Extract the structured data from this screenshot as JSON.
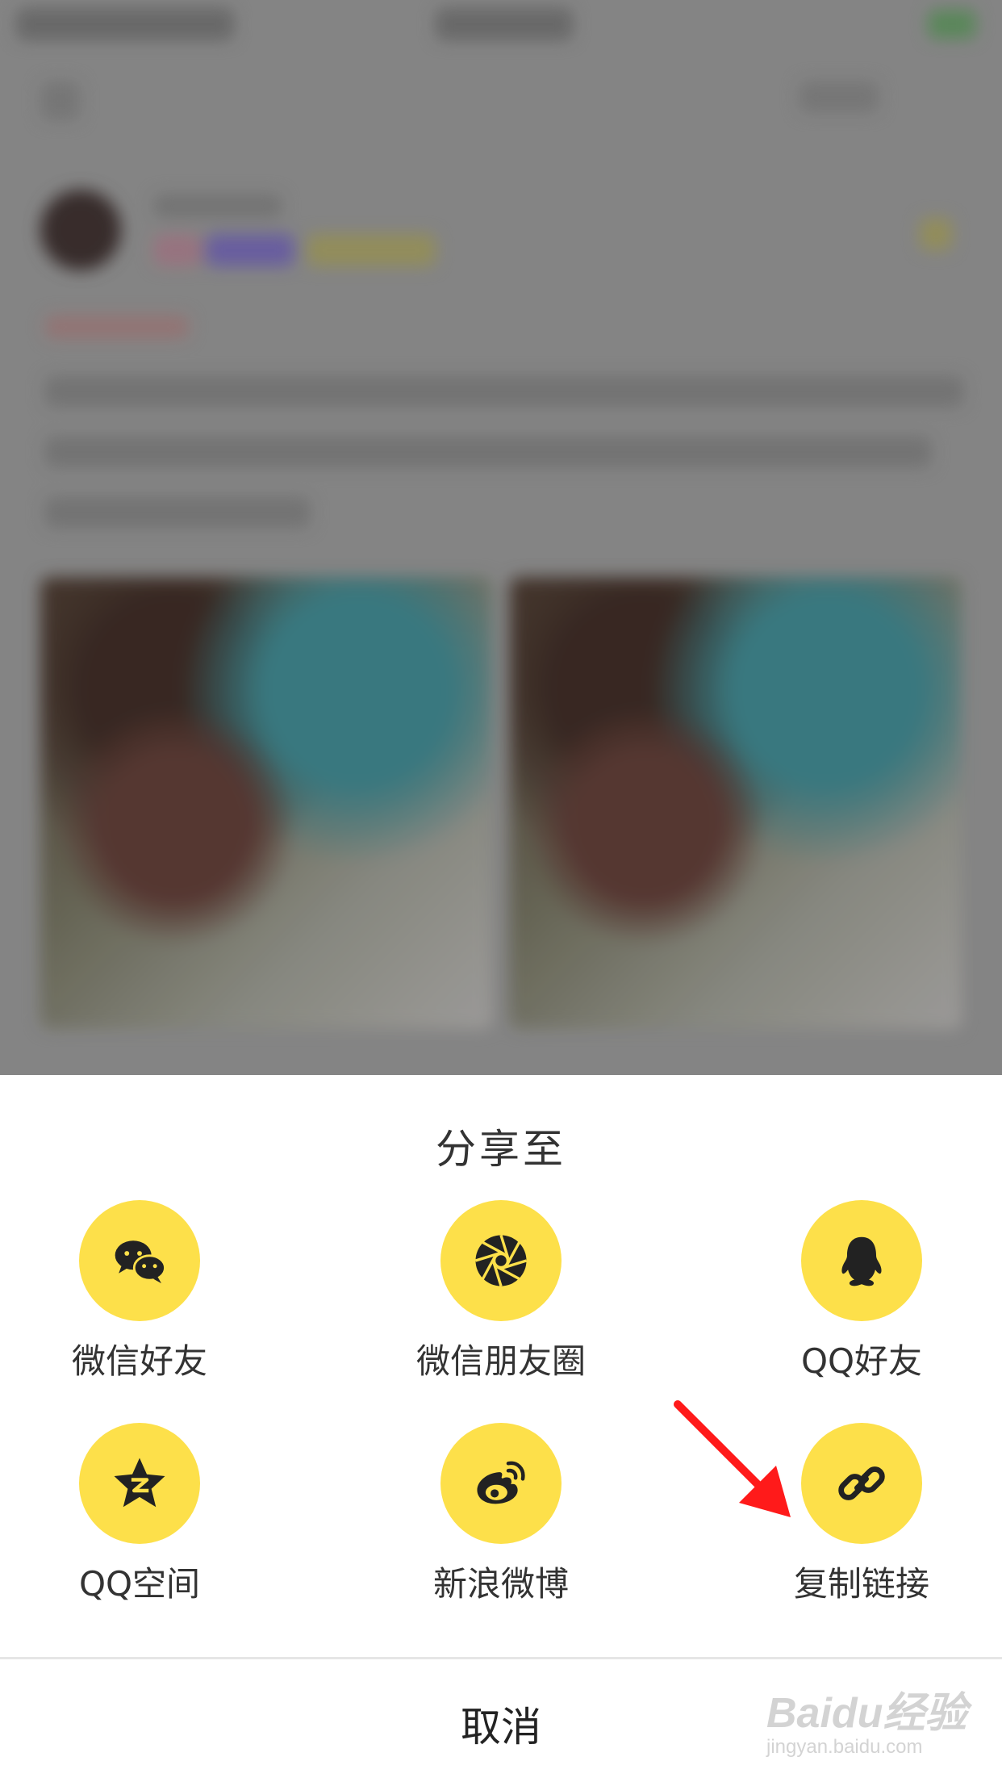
{
  "background": {
    "blurred": true
  },
  "share_sheet": {
    "title": "分享至",
    "items": [
      {
        "label": "微信好友",
        "icon": "wechat-icon"
      },
      {
        "label": "微信朋友圈",
        "icon": "moments-icon"
      },
      {
        "label": "QQ好友",
        "icon": "qq-icon"
      },
      {
        "label": "QQ空间",
        "icon": "qzone-icon"
      },
      {
        "label": "新浪微博",
        "icon": "weibo-icon"
      },
      {
        "label": "复制链接",
        "icon": "link-icon"
      }
    ],
    "cancel_label": "取消",
    "accent_color": "#fde04a"
  },
  "annotation": {
    "arrow_color": "#ff1a1a"
  },
  "watermark": {
    "main": "Baidu经验",
    "sub": "jingyan.baidu.com"
  }
}
